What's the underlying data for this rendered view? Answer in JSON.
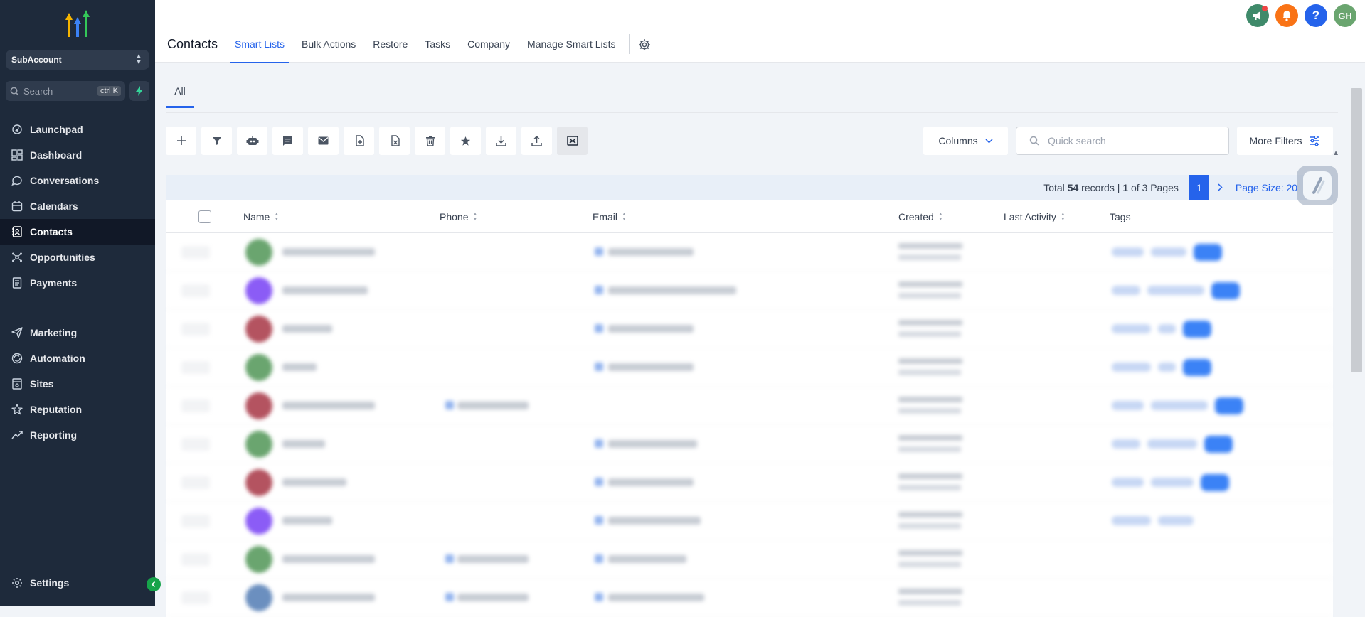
{
  "sidebar": {
    "account": "SubAccount",
    "search_placeholder": "Search",
    "search_shortcut": "ctrl K",
    "items": [
      {
        "label": "Launchpad",
        "icon": "launchpad-icon"
      },
      {
        "label": "Dashboard",
        "icon": "dashboard-icon"
      },
      {
        "label": "Conversations",
        "icon": "conversations-icon"
      },
      {
        "label": "Calendars",
        "icon": "calendar-icon"
      },
      {
        "label": "Contacts",
        "icon": "contacts-icon",
        "active": true
      },
      {
        "label": "Opportunities",
        "icon": "opportunities-icon"
      },
      {
        "label": "Payments",
        "icon": "payments-icon"
      }
    ],
    "items2": [
      {
        "label": "Marketing",
        "icon": "marketing-icon"
      },
      {
        "label": "Automation",
        "icon": "automation-icon"
      },
      {
        "label": "Sites",
        "icon": "sites-icon"
      },
      {
        "label": "Reputation",
        "icon": "reputation-icon"
      },
      {
        "label": "Reporting",
        "icon": "reporting-icon"
      }
    ],
    "settings": "Settings"
  },
  "header": {
    "title": "Contacts",
    "tabs": [
      "Smart Lists",
      "Bulk Actions",
      "Restore",
      "Tasks",
      "Company",
      "Manage Smart Lists"
    ],
    "active_tab": "Smart Lists",
    "avatar_initials": "GH"
  },
  "lists": {
    "tabs": [
      "All"
    ]
  },
  "toolbar": {
    "icons": [
      "add-icon",
      "filter-icon",
      "bot-icon",
      "message-icon",
      "email-icon",
      "tag-add-icon",
      "tag-remove-icon",
      "delete-icon",
      "star-icon",
      "download-icon",
      "upload-icon",
      "merge-icon"
    ],
    "columns_label": "Columns",
    "search_placeholder": "Quick search",
    "more_filters_label": "More Filters"
  },
  "pagination": {
    "total_prefix": "Total",
    "total": "54",
    "records_label": "records |",
    "page": "1",
    "of_label": "of",
    "pages": "3",
    "pages_label": "Pages",
    "current_page_button": "1",
    "page_size_label": "Page Size: 20"
  },
  "table": {
    "columns": [
      "Name",
      "Phone",
      "Email",
      "Created",
      "Last Activity",
      "Tags"
    ]
  },
  "colors": {
    "sidebar_bg": "#1e2a3b",
    "accent": "#2563eb",
    "avatar_green": "#6aa56f",
    "avatar_purple": "#8b5cf6",
    "avatar_red": "#b45360"
  }
}
